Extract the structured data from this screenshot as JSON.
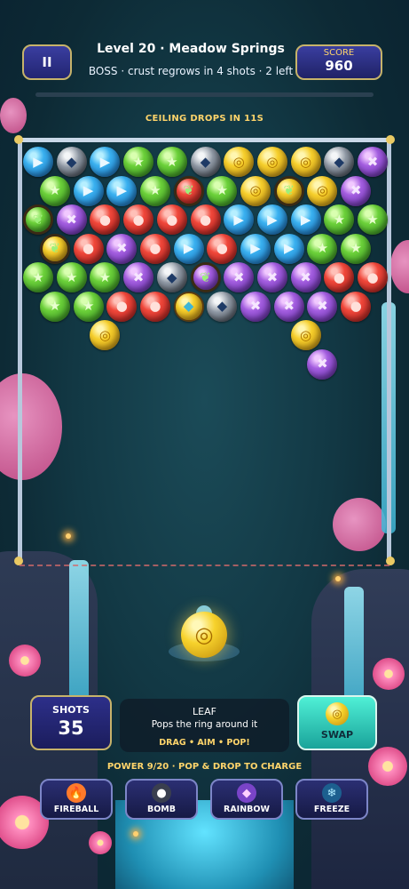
{
  "hud": {
    "pause_label": "II",
    "level_title": "Level 20 · Meadow Springs",
    "boss_status": "BOSS · crust regrows in 4 shots · 2 left",
    "score_label": "SCORE",
    "score_value": "960"
  },
  "ceiling_text": "CEILING DROPS IN 11S",
  "board": {
    "rows": [
      [
        "blue",
        "crust",
        "blue",
        "green",
        "green",
        "crust",
        "yellow",
        "yellow",
        "yellow",
        "crust",
        "purple"
      ],
      [
        "green",
        "blue",
        "blue",
        "green",
        "leaf-red",
        "green",
        "yellow",
        "leaf-yellow",
        "yellow",
        "purple"
      ],
      [
        "leaf-green",
        "purple",
        "red",
        "red",
        "red",
        "red",
        "blue",
        "blue",
        "blue",
        "green",
        "green"
      ],
      [
        "leaf-yellow",
        "red",
        "purple",
        "red",
        "blue",
        "red",
        "blue",
        "blue",
        "green",
        "green"
      ],
      [
        "green",
        "green",
        "green",
        "purple",
        "crust",
        "leaf-purple",
        "purple",
        "purple",
        "purple",
        "red",
        "red"
      ],
      [
        "green",
        "green",
        "red",
        "red",
        "boss",
        "crust",
        "purple",
        "purple",
        "purple",
        "red"
      ],
      [
        "empty",
        "empty",
        "yellow",
        "empty",
        "empty",
        "empty",
        "empty",
        "empty",
        "yellow"
      ],
      [
        "empty",
        "empty",
        "empty",
        "empty",
        "empty",
        "empty",
        "empty",
        "empty",
        "purple"
      ]
    ],
    "symbols": {
      "blue": "▶",
      "green": "★",
      "red": "●",
      "yellow": "◎",
      "purple": "✖",
      "crust": "◆",
      "leaf": "❦"
    },
    "colors": {
      "blue": "#2f9be6",
      "green": "#56c232",
      "red": "#e43a30",
      "yellow": "#f2c524",
      "purple": "#9b52d8",
      "crust": "#8f98a4"
    }
  },
  "shooter": {
    "color": "yellow",
    "symbol": "◎"
  },
  "shots": {
    "label": "SHOTS",
    "value": "35"
  },
  "info_panel": {
    "name": "LEAF",
    "description": "Pops the ring around it",
    "tip": "DRAG • AIM • POP!"
  },
  "swap": {
    "label": "SWAP",
    "symbol": "◎"
  },
  "power_text": "POWER 9/20 · POP & DROP TO CHARGE",
  "powerups": [
    {
      "label": "FIREBALL",
      "icon": "fireball-icon",
      "glyph": "🔥",
      "color": "#ff7a2a"
    },
    {
      "label": "BOMB",
      "icon": "bomb-icon",
      "glyph": "●",
      "color": "#3a3f4f"
    },
    {
      "label": "RAINBOW",
      "icon": "rainbow-gem-icon",
      "glyph": "◆",
      "color": "#c37bff"
    },
    {
      "label": "FREEZE",
      "icon": "snowflake-icon",
      "glyph": "❄",
      "color": "#6fd6ff"
    }
  ]
}
